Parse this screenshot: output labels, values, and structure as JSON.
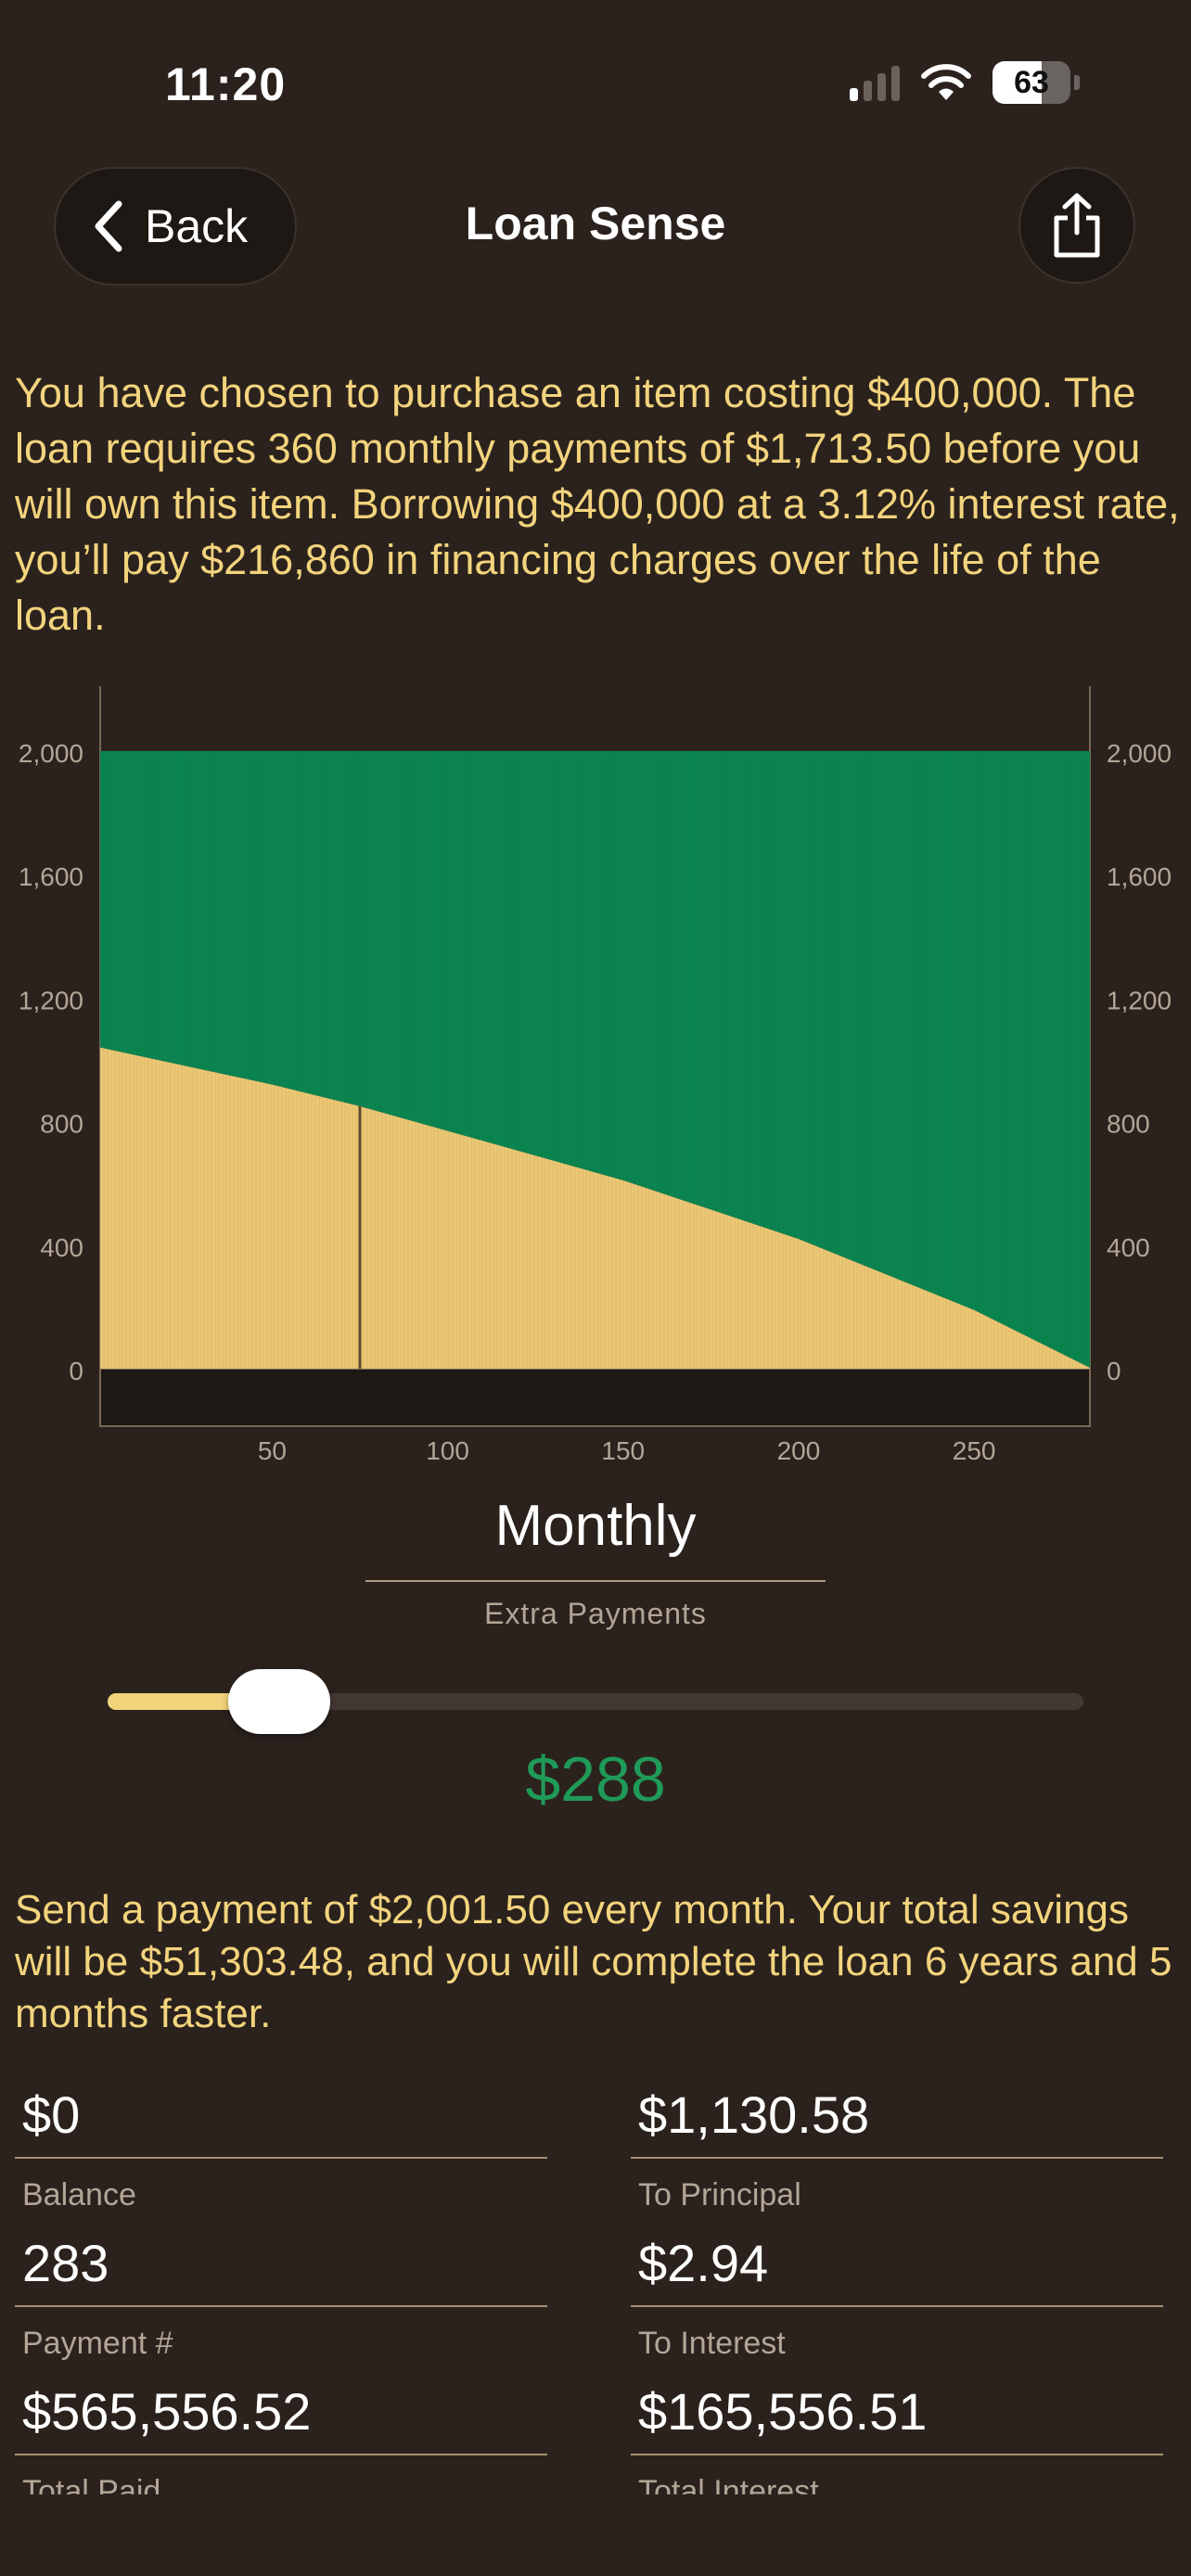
{
  "status_bar": {
    "time": "11:20",
    "battery": "63"
  },
  "nav": {
    "back_label": "Back",
    "title": "Loan Sense"
  },
  "intro_text": "You have chosen to purchase an item costing $400,000. The loan requires 360 monthly payments of $1,713.50 before you will own this item. Borrowing $400,000 at a 3.12% interest rate, you’ll pay $216,860 in financing charges over the life of the loan.",
  "chart_data": {
    "type": "area",
    "stacked": true,
    "x_ticks": [
      50,
      100,
      150,
      200,
      250
    ],
    "xlim": [
      1,
      283
    ],
    "y_ticks": [
      0,
      400,
      800,
      1200,
      1600,
      2000
    ],
    "ylim": [
      0,
      2000
    ],
    "series": [
      {
        "x": [
          1,
          50,
          75,
          100,
          150,
          200,
          250,
          283
        ],
        "values": [
          1040,
          920,
          850,
          770,
          610,
          420,
          190,
          3
        ]
      },
      {
        "x": [
          1,
          50,
          75,
          100,
          150,
          200,
          250,
          283
        ],
        "values": [
          960,
          1080,
          1150,
          1230,
          1390,
          1580,
          1810,
          1997
        ]
      }
    ],
    "marker_x": 75,
    "colors": {
      "interest": "#ebc774",
      "principal": "#0b8550"
    }
  },
  "mode": {
    "title": "Monthly",
    "subtitle": "Extra Payments"
  },
  "slider": {
    "value_label": "$288",
    "fraction": 0.1
  },
  "summary_text": "Send a payment of $2,001.50 every month. Your total savings will be $51,303.48, and you will complete the loan 6 years and 5 months faster.",
  "stats": [
    {
      "value": "$0",
      "label": "Balance"
    },
    {
      "value": "$1,130.58",
      "label": "To Principal"
    },
    {
      "value": "283",
      "label": "Payment #"
    },
    {
      "value": "$2.94",
      "label": "To Interest"
    },
    {
      "value": "$565,556.52",
      "label": "Total Paid"
    },
    {
      "value": "$165,556.51",
      "label": "Total Interest"
    }
  ]
}
